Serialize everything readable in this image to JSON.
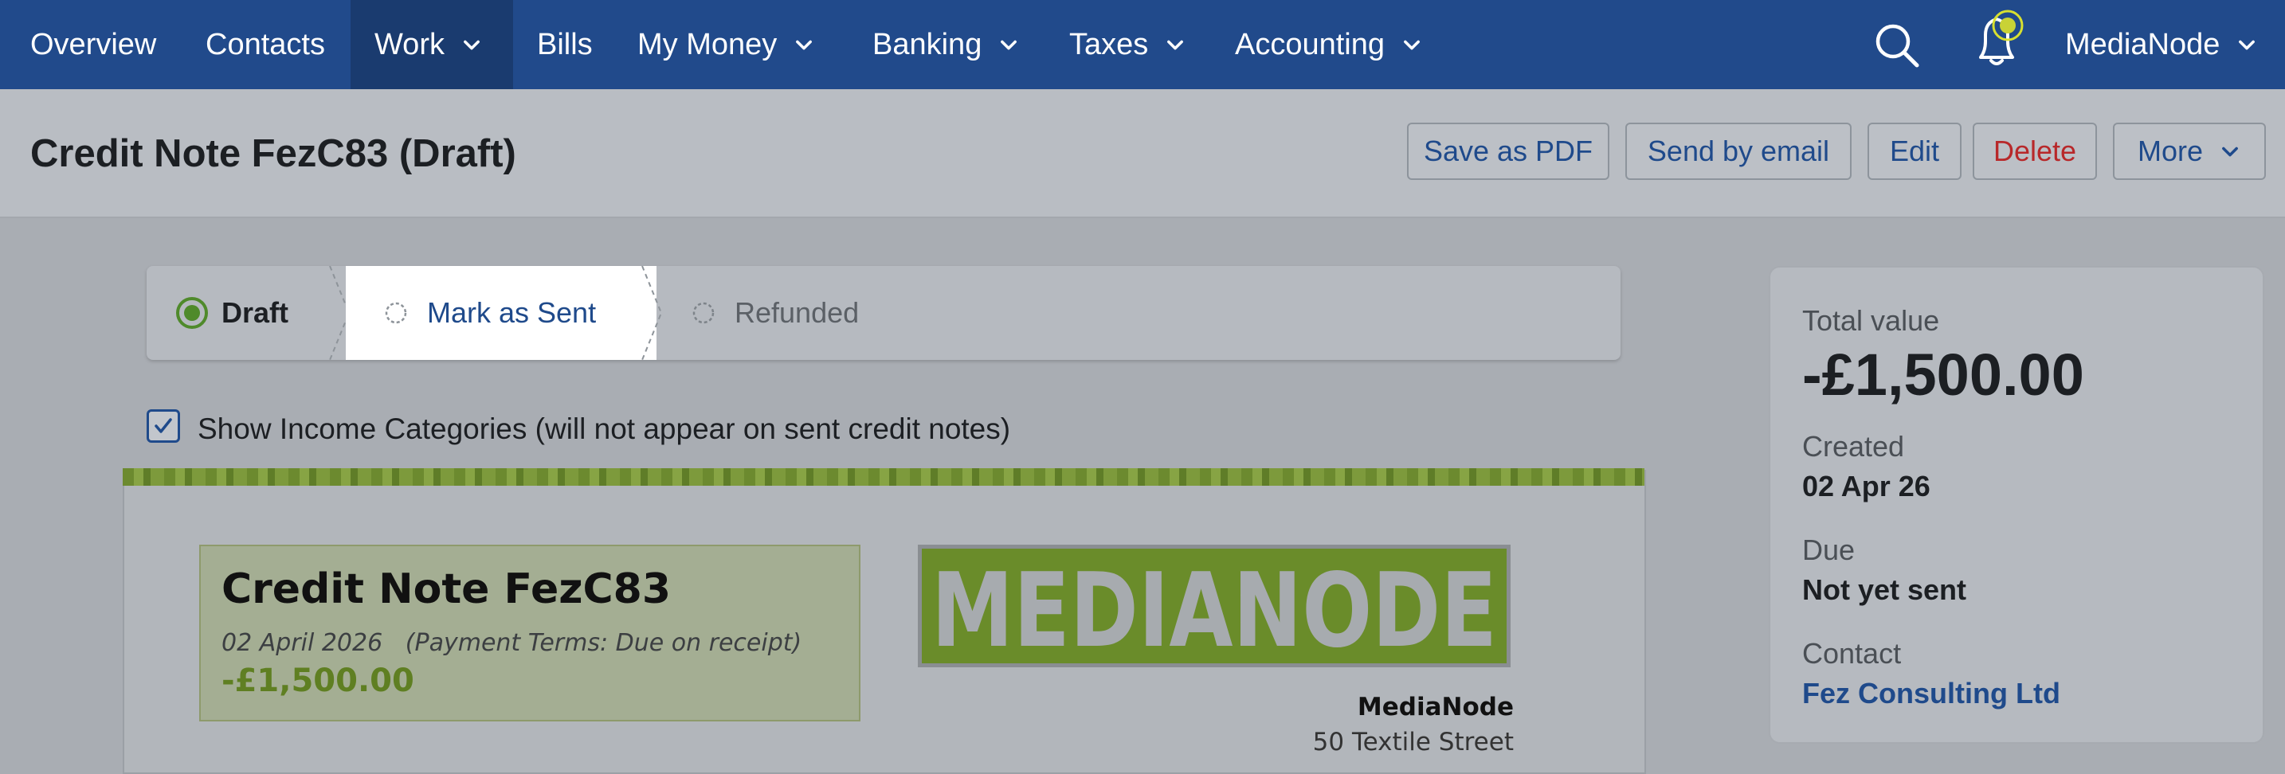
{
  "nav": {
    "items": [
      {
        "label": "Overview",
        "dropdown": false
      },
      {
        "label": "Contacts",
        "dropdown": false
      },
      {
        "label": "Work",
        "dropdown": true,
        "active": true
      },
      {
        "label": "Bills",
        "dropdown": false
      },
      {
        "label": "My Money",
        "dropdown": true
      },
      {
        "label": "Banking",
        "dropdown": true
      },
      {
        "label": "Taxes",
        "dropdown": true
      },
      {
        "label": "Accounting",
        "dropdown": true
      }
    ],
    "account_name": "MediaNode",
    "icons": {
      "search": "search-icon",
      "notifications": "bell-icon",
      "account_menu": "chevron-down-icon"
    }
  },
  "page": {
    "title": "Credit Note FezC83 (Draft)"
  },
  "header_buttons": {
    "save_pdf": "Save as PDF",
    "send_email": "Send by email",
    "edit": "Edit",
    "delete": "Delete",
    "more": "More"
  },
  "status_steps": [
    {
      "label": "Draft",
      "state": "current"
    },
    {
      "label": "Mark as Sent",
      "state": "action"
    },
    {
      "label": "Refunded",
      "state": "pending"
    }
  ],
  "options": {
    "show_income_categories": true,
    "show_income_categories_label": "Show Income Categories (will not appear on sent credit notes)"
  },
  "document": {
    "title": "Credit Note FezC83",
    "date": "02 April 2026",
    "payment_terms": "(Payment Terms: Due on receipt)",
    "amount": "-£1,500.00",
    "logo_text": "MEDIANODE",
    "from_name": "MediaNode",
    "from_street": "50 Textile Street"
  },
  "summary_panel": {
    "total_label": "Total value",
    "total_value": "-£1,500.00",
    "created_label": "Created",
    "created_value": "02 Apr 26",
    "due_label": "Due",
    "due_value": "Not yet sent",
    "contact_label": "Contact",
    "contact_value": "Fez Consulting Ltd"
  },
  "colors": {
    "nav_bg": "#214a8b",
    "link": "#1f4a8b",
    "danger": "#b8282a",
    "brand_green": "#6a8c2a",
    "draft_green": "#4f8a2b"
  }
}
